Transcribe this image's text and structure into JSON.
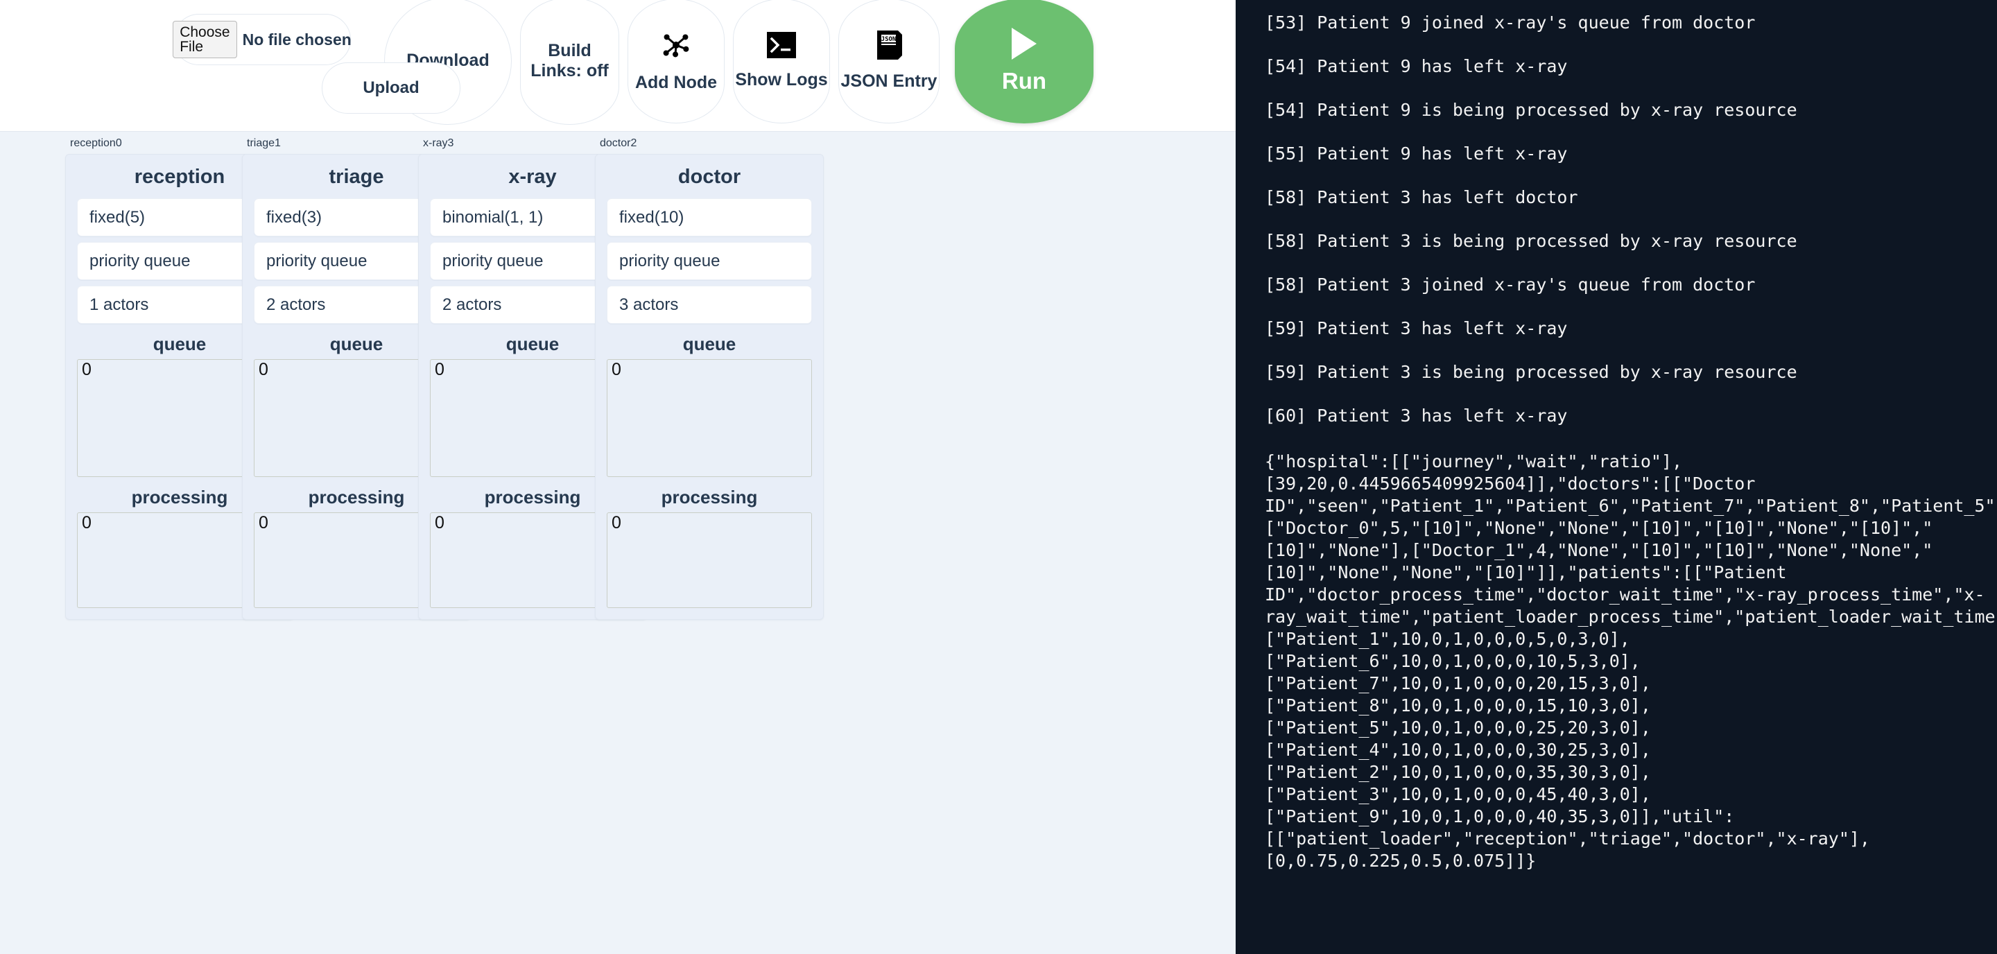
{
  "toolbar": {
    "file_input": {
      "button_label": "Choose File",
      "status": "No file chosen"
    },
    "upload_label": "Upload",
    "download_label": "Download",
    "build_links_label": "Build Links: off",
    "add_node_label": "Add Node",
    "add_node_icon": "network-graph-icon",
    "show_logs_label": "Show Logs",
    "show_logs_icon": "terminal-icon",
    "json_entry_label": "JSON Entry",
    "json_entry_icon": "json-file-icon",
    "run_label": "Run",
    "run_icon": "play-icon",
    "run_color": "#6cc070"
  },
  "canvas": {
    "background": "#eef3f9",
    "node_background": "#e8eef8",
    "edge_color": "#8a98a8",
    "nodes": [
      {
        "id": "reception0",
        "title": "reception",
        "distribution": "fixed(5)",
        "queue_type": "priority queue",
        "actors": "1 actors",
        "queue_label": "queue",
        "queue_count": "0",
        "processing_label": "processing",
        "processing_count": "0"
      },
      {
        "id": "triage1",
        "title": "triage",
        "distribution": "fixed(3)",
        "queue_type": "priority queue",
        "actors": "2 actors",
        "queue_label": "queue",
        "queue_count": "0",
        "processing_label": "processing",
        "processing_count": "0"
      },
      {
        "id": "x-ray3",
        "title": "x-ray",
        "distribution": "binomial(1, 1)",
        "queue_type": "priority queue",
        "actors": "2 actors",
        "queue_label": "queue",
        "queue_count": "0",
        "processing_label": "processing",
        "processing_count": "0"
      },
      {
        "id": "doctor2",
        "title": "doctor",
        "distribution": "fixed(10)",
        "queue_type": "priority queue",
        "actors": "3 actors",
        "queue_label": "queue",
        "queue_count": "0",
        "processing_label": "processing",
        "processing_count": "0"
      }
    ]
  },
  "log": {
    "background": "#0d1623",
    "lines": [
      "[53] Patient 9 joined x-ray's queue from doctor",
      "[54] Patient 9 has left x-ray",
      "[54] Patient 9 is being processed by x-ray resource",
      "[55] Patient 9 has left x-ray",
      "[58] Patient 3 has left doctor",
      "[58] Patient 3 is being processed by x-ray resource",
      "[58] Patient 3 joined x-ray's queue from doctor",
      "[59] Patient 3 has left x-ray",
      "[59] Patient 3 is being processed by x-ray resource",
      "[60] Patient 3 has left x-ray"
    ],
    "json_output": "{\"hospital\":[[\"journey\",\"wait\",\"ratio\"],\n[39,20,0.4459665409925604]],\"doctors\":[[\"Doctor\nID\",\"seen\",\"Patient_1\",\"Patient_6\",\"Patient_7\",\"Patient_8\",\"Patient_5\"\n[\"Doctor_0\",5,\"[10]\",\"None\",\"None\",\"[10]\",\"[10]\",\"None\",\"[10]\",\"\n[10]\",\"None\"],[\"Doctor_1\",4,\"None\",\"[10]\",\"[10]\",\"None\",\"None\",\"\n[10]\",\"None\",\"None\",\"[10]\"]],\"patients\":[[\"Patient\nID\",\"doctor_process_time\",\"doctor_wait_time\",\"x-ray_process_time\",\"x-\nray_wait_time\",\"patient_loader_process_time\",\"patient_loader_wait_time\n[\"Patient_1\",10,0,1,0,0,0,5,0,3,0],\n[\"Patient_6\",10,0,1,0,0,0,10,5,3,0],\n[\"Patient_7\",10,0,1,0,0,0,20,15,3,0],\n[\"Patient_8\",10,0,1,0,0,0,15,10,3,0],\n[\"Patient_5\",10,0,1,0,0,0,25,20,3,0],\n[\"Patient_4\",10,0,1,0,0,0,30,25,3,0],\n[\"Patient_2\",10,0,1,0,0,0,35,30,3,0],\n[\"Patient_3\",10,0,1,0,0,0,45,40,3,0],\n[\"Patient_9\",10,0,1,0,0,0,40,35,3,0]],\"util\":\n[[\"patient_loader\",\"reception\",\"triage\",\"doctor\",\"x-ray\"],\n[0,0.75,0.225,0.5,0.075]]}"
  }
}
